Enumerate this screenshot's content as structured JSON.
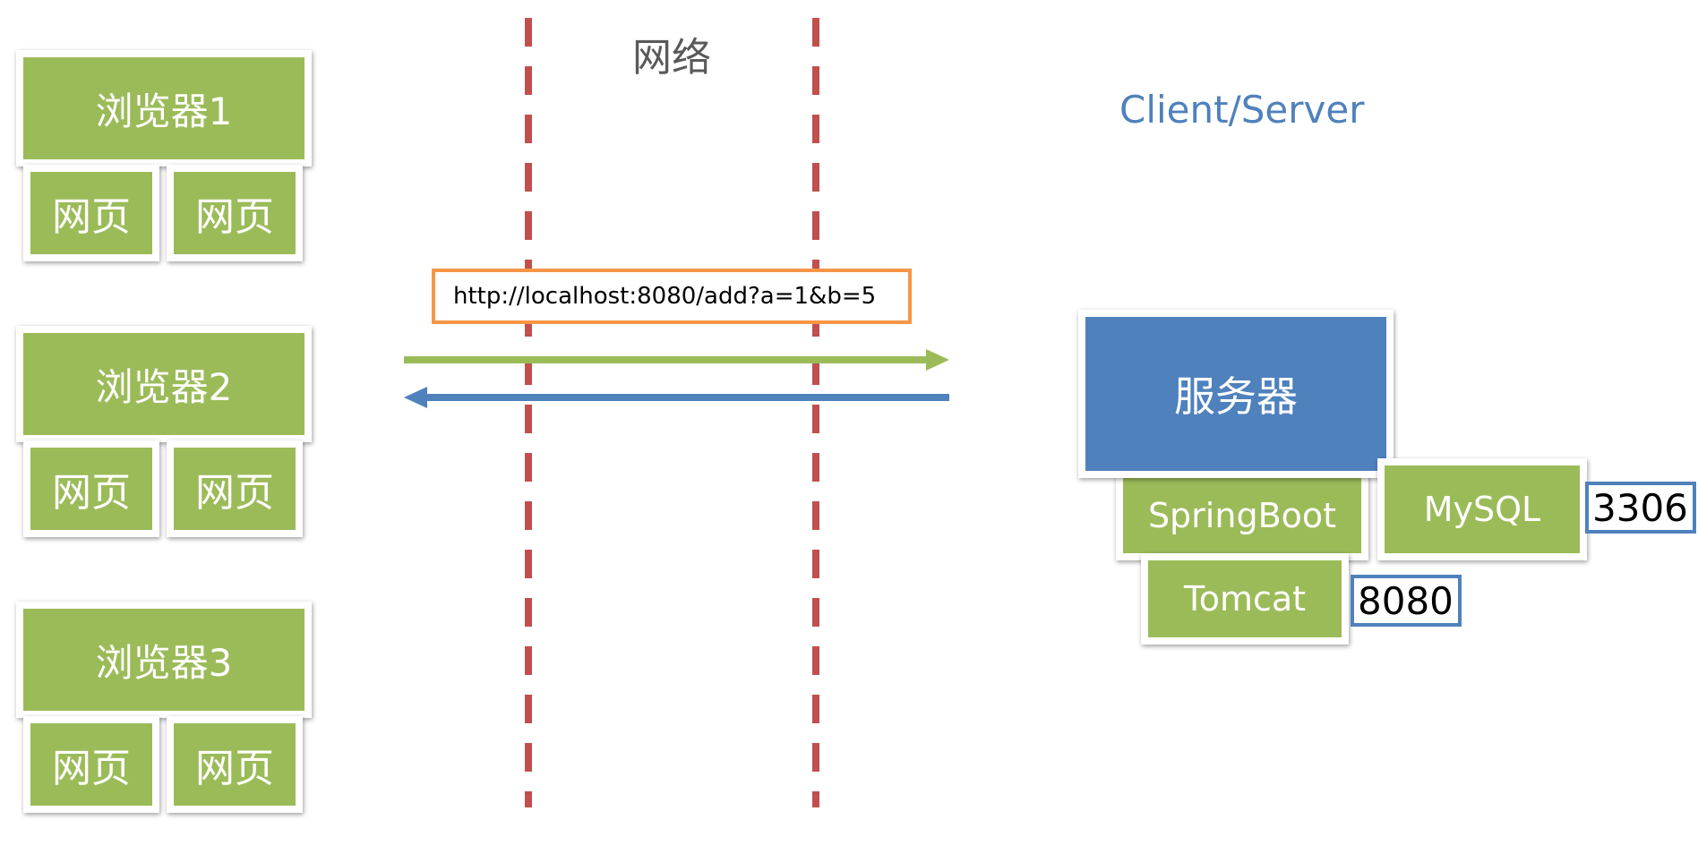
{
  "network_label": "网络",
  "architecture_label": "Client/Server",
  "colors": {
    "green_box": "#9bbb59",
    "blue_box": "#4f81bd",
    "divider": "#c0504d",
    "url_border": "#f79646",
    "request_arrow": "#9bbb59",
    "response_arrow": "#4f81bd",
    "port_border": "#4f81bd",
    "label_gray": "#595959"
  },
  "clients": [
    {
      "browser": "浏览器1",
      "pages": [
        "网页",
        "网页"
      ]
    },
    {
      "browser": "浏览器2",
      "pages": [
        "网页",
        "网页"
      ]
    },
    {
      "browser": "浏览器3",
      "pages": [
        "网页",
        "网页"
      ]
    }
  ],
  "request_url": "http://localhost:8080/add?a=1&b=5",
  "server": {
    "label": "服务器",
    "framework": "SpringBoot",
    "database": "MySQL",
    "database_port": "3306",
    "container": "Tomcat",
    "container_port": "8080"
  }
}
